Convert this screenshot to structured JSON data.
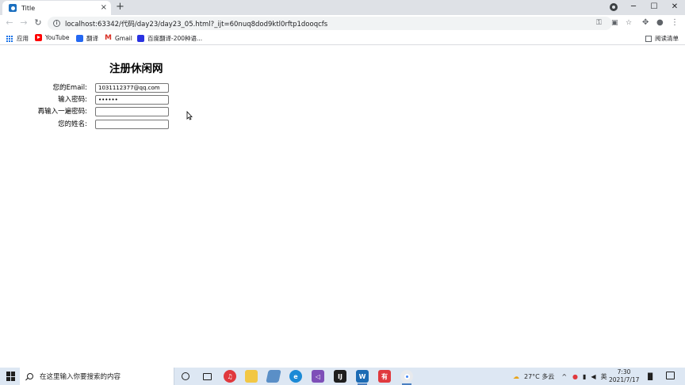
{
  "browser": {
    "tab": {
      "title": "Title",
      "close": "×"
    },
    "new_tab": "+",
    "window_controls": {
      "minimize": "─",
      "maximize": "☐",
      "close": "✕"
    },
    "nav": {
      "back": "←",
      "forward": "→",
      "reload": "↻"
    },
    "url": "localhost:63342/代码/day23/day23_05.html?_ijt=60nuq8dod9ktl0rftp1dooqcfs",
    "info": "i"
  },
  "bookmarks": {
    "apps": "应用",
    "items": [
      "YouTube",
      "翻译",
      "Gmail",
      "百度翻译-200种语..."
    ],
    "reading_list": "阅读清单"
  },
  "page": {
    "title": "注册休闲网",
    "form": {
      "email_label": "您的Email:",
      "email_value": "1031112377@qq.com",
      "password_label": "输入密码:",
      "password_value": "••••••",
      "confirm_label": "再输入一遍密码:",
      "confirm_value": "",
      "name_label": "您的姓名:",
      "name_value": ""
    }
  },
  "taskbar": {
    "search_placeholder": "在这里输入你要搜索的内容",
    "weather": "27°C 多云",
    "ime": "英",
    "time": "7:30",
    "date": "2021/7/17"
  },
  "colors": {
    "tabstrip": "#dee1e6",
    "taskbar": "#dde7f3",
    "accent": "#1a73e8"
  }
}
